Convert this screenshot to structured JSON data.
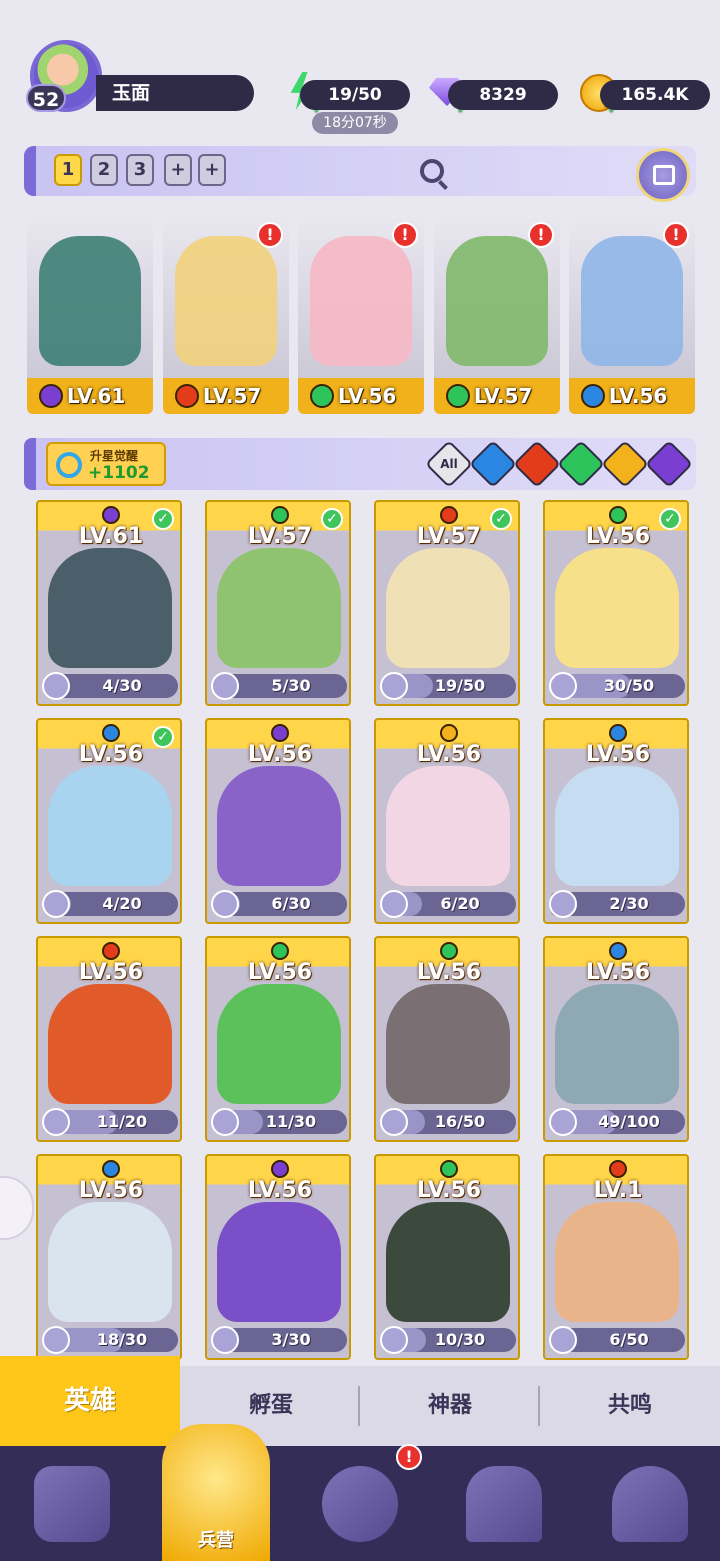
{
  "player": {
    "name": "玉面",
    "level": "52"
  },
  "resources": {
    "energy": "19/50",
    "energy_timer": "18分07秒",
    "gems": "8329",
    "coins": "165.4K"
  },
  "team_slots": [
    "1",
    "2",
    "3",
    "+",
    "+"
  ],
  "team": [
    {
      "level": "LV.61",
      "element": "dark",
      "color": "#7a3fd1",
      "art": "#3d7f74",
      "alert": ""
    },
    {
      "level": "LV.57",
      "element": "fire",
      "color": "#e23c1a",
      "art": "#f2d27b",
      "alert": "!"
    },
    {
      "level": "LV.56",
      "element": "wind",
      "color": "#2ec45c",
      "art": "#f6b8c4",
      "alert": "!"
    },
    {
      "level": "LV.57",
      "element": "wind",
      "color": "#2ec45c",
      "art": "#7fb96a",
      "alert": "!"
    },
    {
      "level": "LV.56",
      "element": "water",
      "color": "#2b86e2",
      "art": "#8fb6e8",
      "alert": "!"
    }
  ],
  "awaken": {
    "title": "升星觉醒",
    "count": "+1102"
  },
  "filters": {
    "all_label": "All"
  },
  "heroes": [
    {
      "level": "LV.61",
      "element": "dark",
      "color": "#7a3fd1",
      "art": "#4a5f69",
      "shards": "4/30",
      "progress": 0.13,
      "checked": true
    },
    {
      "level": "LV.57",
      "element": "wind",
      "color": "#2ec45c",
      "art": "#8fc36f",
      "shards": "5/30",
      "progress": 0.17,
      "checked": true
    },
    {
      "level": "LV.57",
      "element": "fire",
      "color": "#e23c1a",
      "art": "#efe1b5",
      "shards": "19/50",
      "progress": 0.38,
      "checked": true
    },
    {
      "level": "LV.56",
      "element": "wind",
      "color": "#2ec45c",
      "art": "#f6e08a",
      "shards": "30/50",
      "progress": 0.6,
      "checked": true
    },
    {
      "level": "LV.56",
      "element": "water",
      "color": "#2b86e2",
      "art": "#a9d4ef",
      "shards": "4/20",
      "progress": 0.2,
      "checked": true
    },
    {
      "level": "LV.56",
      "element": "dark",
      "color": "#7a3fd1",
      "art": "#8a63c9",
      "shards": "6/30",
      "progress": 0.2,
      "checked": false
    },
    {
      "level": "LV.56",
      "element": "light",
      "color": "#f3b21c",
      "art": "#f3d6e4",
      "shards": "6/20",
      "progress": 0.3,
      "checked": false
    },
    {
      "level": "LV.56",
      "element": "water",
      "color": "#2b86e2",
      "art": "#c6dcf0",
      "shards": "2/30",
      "progress": 0.07,
      "checked": false
    },
    {
      "level": "LV.56",
      "element": "fire",
      "color": "#e23c1a",
      "art": "#e05a2a",
      "shards": "11/20",
      "progress": 0.55,
      "checked": false
    },
    {
      "level": "LV.56",
      "element": "wind",
      "color": "#2ec45c",
      "art": "#5cc15a",
      "shards": "11/30",
      "progress": 0.37,
      "checked": false
    },
    {
      "level": "LV.56",
      "element": "wind",
      "color": "#2ec45c",
      "art": "#7a6f72",
      "shards": "16/50",
      "progress": 0.32,
      "checked": false
    },
    {
      "level": "LV.56",
      "element": "water",
      "color": "#2b86e2",
      "art": "#8fa9b4",
      "shards": "49/100",
      "progress": 0.49,
      "checked": false
    },
    {
      "level": "LV.56",
      "element": "water",
      "color": "#2b86e2",
      "art": "#d9e4ef",
      "shards": "18/30",
      "progress": 0.6,
      "checked": false
    },
    {
      "level": "LV.56",
      "element": "dark",
      "color": "#7a3fd1",
      "art": "#7a4fc8",
      "shards": "3/30",
      "progress": 0.1,
      "checked": false
    },
    {
      "level": "LV.56",
      "element": "wind",
      "color": "#2ec45c",
      "art": "#3c4a3e",
      "shards": "10/30",
      "progress": 0.33,
      "checked": false
    },
    {
      "level": "LV.1",
      "element": "fire",
      "color": "#e23c1a",
      "art": "#e9b48a",
      "shards": "6/50",
      "progress": 0.12,
      "checked": false
    }
  ],
  "tabs": {
    "heroes": "英雄",
    "eggs": "孵蛋",
    "artifacts": "神器",
    "resonance": "共鸣"
  },
  "nav": {
    "barracks": "兵营",
    "alert": "!"
  }
}
